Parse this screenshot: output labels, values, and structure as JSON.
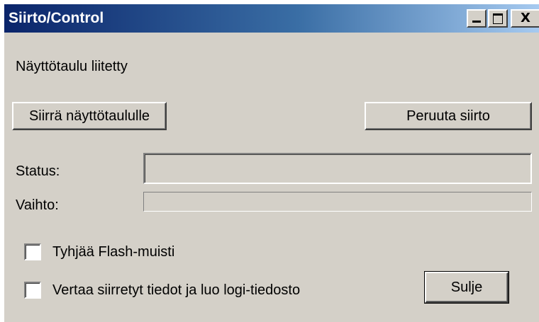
{
  "window": {
    "title": "Siirto/Control",
    "minimize_glyph": "minimize-icon",
    "maximize_glyph": "maximize-icon",
    "close_label": "X"
  },
  "status_message": "Näyttötaulu liitetty",
  "buttons": {
    "transfer": "Siirrä näyttötaululle",
    "cancel_transfer": "Peruuta siirto",
    "close": "Sulje"
  },
  "fields": {
    "status_label": "Status:",
    "status_value": "",
    "phase_label": "Vaihto:",
    "phase_progress": 0
  },
  "options": {
    "clear_flash": {
      "label": "Tyhjää Flash-muisti",
      "checked": false
    },
    "compare_log": {
      "label": "Vertaa siirretyt tiedot ja luo logi-tiedosto",
      "checked": false
    }
  }
}
